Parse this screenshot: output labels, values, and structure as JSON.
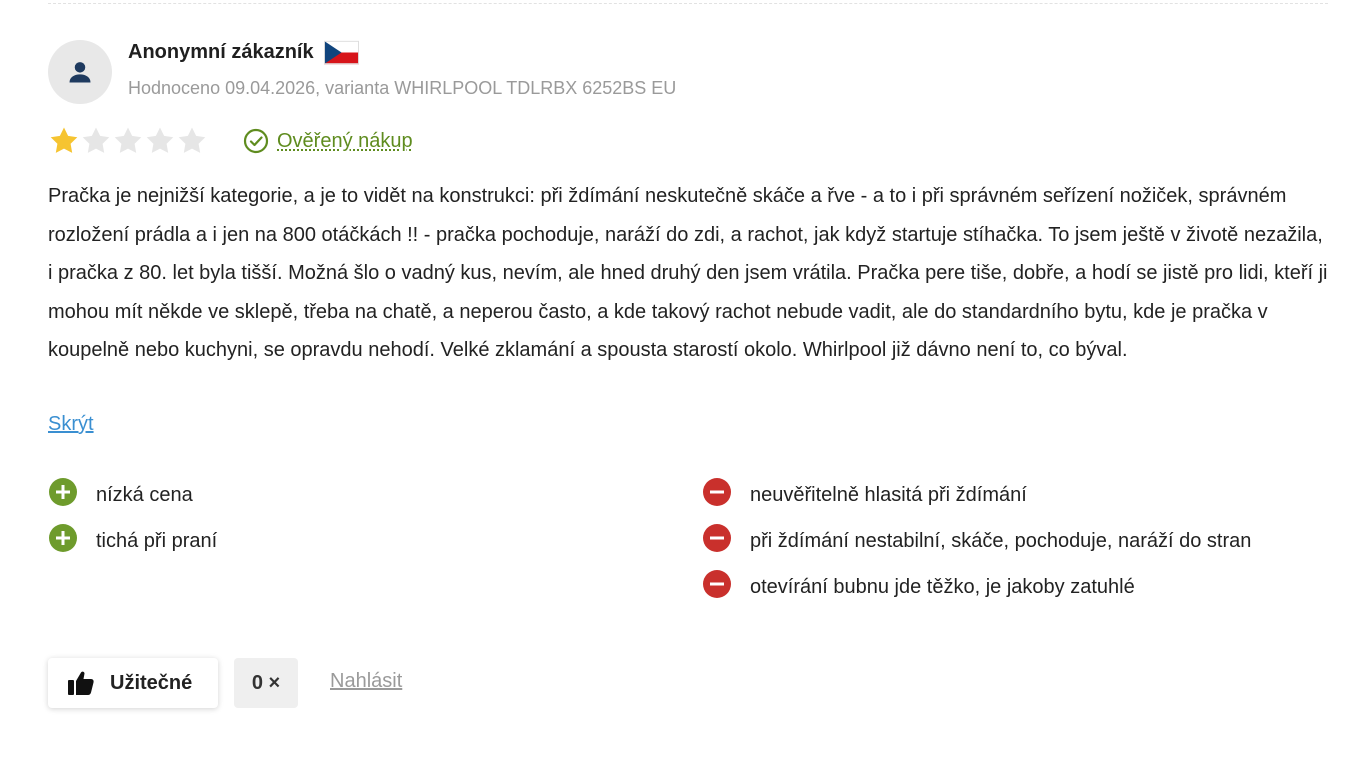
{
  "review": {
    "author": "Anonymní zákazník",
    "meta": "Hodnoceno 09.04.2026, varianta WHIRLPOOL TDLRBX 6252BS EU",
    "rating": 1,
    "rating_max": 5,
    "verified_label": "Ověřený nákup",
    "text": "Pračka je nejnižší kategorie, a je to vidět na konstrukci: při ždímání neskutečně skáče a řve - a to i při správném seřízení nožiček, správném rozložení prádla a i jen na 800 otáčkách !! - pračka pochoduje, naráží do zdi, a rachot, jak když startuje stíhačka. To jsem ještě v životě nezažila, i pračka z 80. let byla tišší. Možná šlo o vadný kus, nevím, ale hned druhý den jsem vrátila. Pračka pere tiše, dobře, a hodí se jistě pro lidi, kteří ji mohou mít někde ve sklepě, třeba na chatě, a neperou často, a kde takový rachot nebude vadit, ale do standardního bytu, kde je pračka v koupelně nebo kuchyni, se opravdu nehodí. Velké zklamání a spousta starostí okolo. Whirlpool již dávno není to, co býval.",
    "hide_label": "Skrýt",
    "pros": [
      "nízká cena",
      "tichá při praní"
    ],
    "cons": [
      "neuvěřitelně hlasitá při ždímání",
      "při ždímání nestabilní, skáče, pochoduje, naráží do stran",
      "otevírání bubnu jde těžko, je jakoby zatuhlé"
    ]
  },
  "actions": {
    "helpful_label": "Užitečné",
    "helpful_count": "0 ×",
    "report_label": "Nahlásit"
  },
  "colors": {
    "star_filled": "#f6c431",
    "star_empty": "#e6e6e6",
    "pro": "#6e9b2c",
    "con": "#c9302c",
    "verified": "#5f8c1f",
    "link": "#3a8fd1"
  },
  "icons": {
    "avatar": "user-icon",
    "flag": "czech-flag-icon",
    "verified": "check-circle-icon",
    "pro": "plus-circle-icon",
    "con": "minus-circle-icon",
    "helpful": "thumbs-up-icon"
  }
}
